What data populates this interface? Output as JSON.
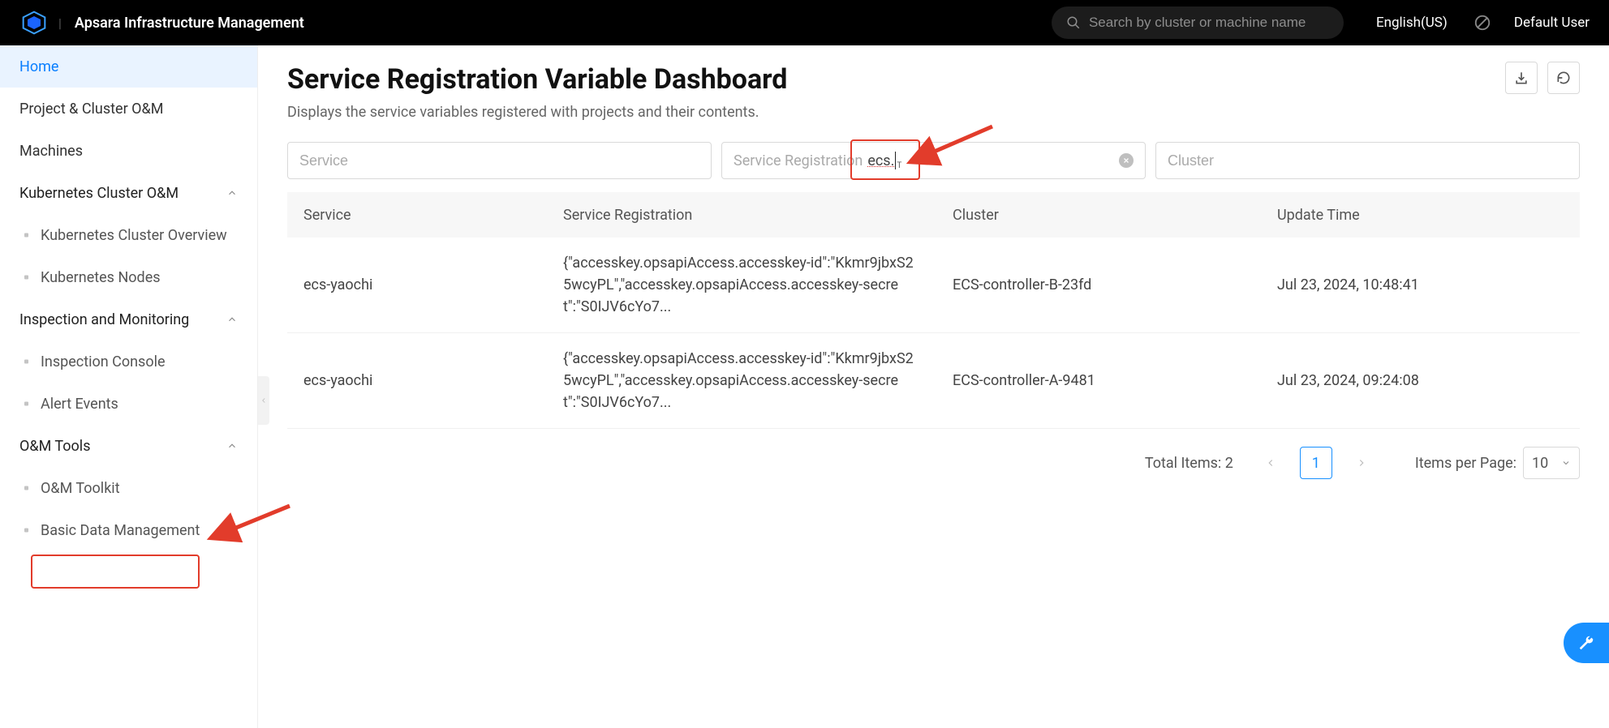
{
  "topbar": {
    "app_title": "Apsara Infrastructure Management",
    "search_placeholder": "Search by cluster or machine name",
    "language": "English(US)",
    "user": "Default User"
  },
  "sidebar": {
    "home": "Home",
    "project_cluster": "Project & Cluster O&M",
    "machines": "Machines",
    "k8s_cluster_om": "Kubernetes Cluster O&M",
    "k8s_overview": "Kubernetes Cluster Overview",
    "k8s_nodes": "Kubernetes Nodes",
    "inspection_monitoring": "Inspection and Monitoring",
    "inspection_console": "Inspection Console",
    "alert_events": "Alert Events",
    "om_tools": "O&M Tools",
    "om_toolkit": "O&M Toolkit",
    "basic_data_mgmt": "Basic Data Management"
  },
  "main": {
    "title": "Service Registration Variable Dashboard",
    "subtitle": "Displays the service variables registered with projects and their contents.",
    "filters": {
      "service_ph": "Service",
      "reg_ph": "Service Registration",
      "reg_value": "ecs.",
      "cluster_ph": "Cluster"
    },
    "columns": {
      "service": "Service",
      "registration": "Service Registration",
      "cluster": "Cluster",
      "update_time": "Update Time"
    },
    "rows": [
      {
        "service": "ecs-yaochi",
        "registration": "{\"accesskey.opsapiAccess.accesskey-id\":\"Kkmr9jbxS25wcyPL\",\"accesskey.opsapiAccess.accesskey-secret\":\"S0IJV6cYo7...",
        "cluster": "ECS-controller-B-23fd",
        "time": "Jul 23, 2024, 10:48:41"
      },
      {
        "service": "ecs-yaochi",
        "registration": "{\"accesskey.opsapiAccess.accesskey-id\":\"Kkmr9jbxS25wcyPL\",\"accesskey.opsapiAccess.accesskey-secret\":\"S0IJV6cYo7...",
        "cluster": "ECS-controller-A-9481",
        "time": "Jul 23, 2024, 09:24:08"
      }
    ],
    "pager": {
      "total_label": "Total Items: 2",
      "current": "1",
      "size_label": "Items per Page:",
      "size_value": "10"
    }
  },
  "icons": {
    "search": "search-icon",
    "download": "download-icon",
    "refresh": "refresh-icon",
    "theme": "theme-toggle-icon",
    "chevron_up": "chevron-up-icon",
    "chevron_left": "chevron-left-icon",
    "chevron_right": "chevron-right-icon",
    "chevron_down": "chevron-down-icon",
    "close_circle": "close-circle-icon",
    "wrench": "wrench-icon"
  },
  "colors": {
    "accent": "#1890ff",
    "annotation": "#e23c2b",
    "topbar_bg": "#000000"
  }
}
